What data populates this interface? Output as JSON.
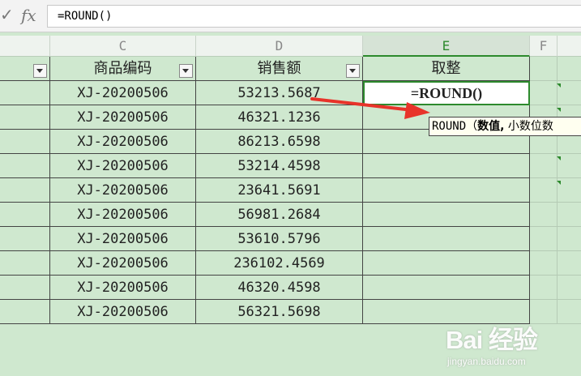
{
  "formula_bar": {
    "check_symbol": "✓",
    "fx_symbol": "fx",
    "value": "=ROUND()"
  },
  "columns": [
    {
      "letter": ""
    },
    {
      "letter": "C"
    },
    {
      "letter": "D"
    },
    {
      "letter": "E",
      "active": true
    },
    {
      "letter": "F"
    }
  ],
  "table": {
    "headers": [
      "",
      "商品编码",
      "销售额",
      "取整"
    ],
    "rows": [
      [
        "",
        "XJ-20200506",
        "53213.5687",
        "=ROUND()"
      ],
      [
        "",
        "XJ-20200506",
        "46321.1236",
        ""
      ],
      [
        "",
        "XJ-20200506",
        "86213.6598",
        ""
      ],
      [
        "",
        "XJ-20200506",
        "53214.4598",
        ""
      ],
      [
        "",
        "XJ-20200506",
        "23641.5691",
        ""
      ],
      [
        "",
        "XJ-20200506",
        "56981.2684",
        ""
      ],
      [
        "",
        "XJ-20200506",
        "53610.5796",
        ""
      ],
      [
        "",
        "XJ-20200506",
        "236102.4569",
        ""
      ],
      [
        "",
        "XJ-20200506",
        "46320.4598",
        ""
      ],
      [
        "",
        "XJ-20200506",
        "56321.5698",
        ""
      ]
    ]
  },
  "tooltip": {
    "func": "ROUND",
    "open": "（",
    "bold_arg": "数值,",
    "rest": " 小数位数"
  },
  "watermark": {
    "main": "Bai 经验",
    "sub": "jingyan.baidu.com"
  },
  "colors": {
    "sheet_background": "#cfe8cf",
    "selection_accent": "#2d8a2d",
    "arrow": "#e8332a",
    "tooltip_background": "#fffff0"
  }
}
